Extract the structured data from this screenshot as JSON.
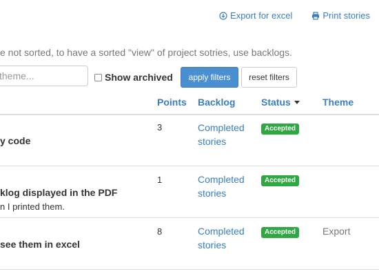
{
  "toolbar": {
    "export_excel": "Export for excel",
    "print_stories": "Print stories"
  },
  "note": "e not sorted, to have a sorted \"view\" of project sotries, use backlogs.",
  "filters": {
    "theme_placeholder": "theme...",
    "show_archived_label": "Show archived",
    "show_archived_checked": false,
    "apply_label": "apply filters",
    "reset_label": "reset filters"
  },
  "table": {
    "headers": {
      "points": "Points",
      "backlog": "Backlog",
      "status": "Status",
      "theme": "Theme"
    },
    "sort_column": "Status",
    "rows": [
      {
        "title": "y code",
        "description": "",
        "points": "3",
        "backlog_line1": "Completed",
        "backlog_line2": "stories",
        "status": "Accepted",
        "theme": ""
      },
      {
        "title": "klog displayed in the PDF",
        "description": "n I printed them.",
        "points": "1",
        "backlog_line1": "Completed",
        "backlog_line2": "stories",
        "status": "Accepted",
        "theme": ""
      },
      {
        "title": "see them in excel",
        "description": "",
        "points": "8",
        "backlog_line1": "Completed",
        "backlog_line2": "stories",
        "status": "Accepted",
        "theme": "Export"
      }
    ]
  },
  "colors": {
    "link": "#3a7ebf",
    "accepted_badge": "#2fa842",
    "primary_button": "#4a8fd0"
  }
}
